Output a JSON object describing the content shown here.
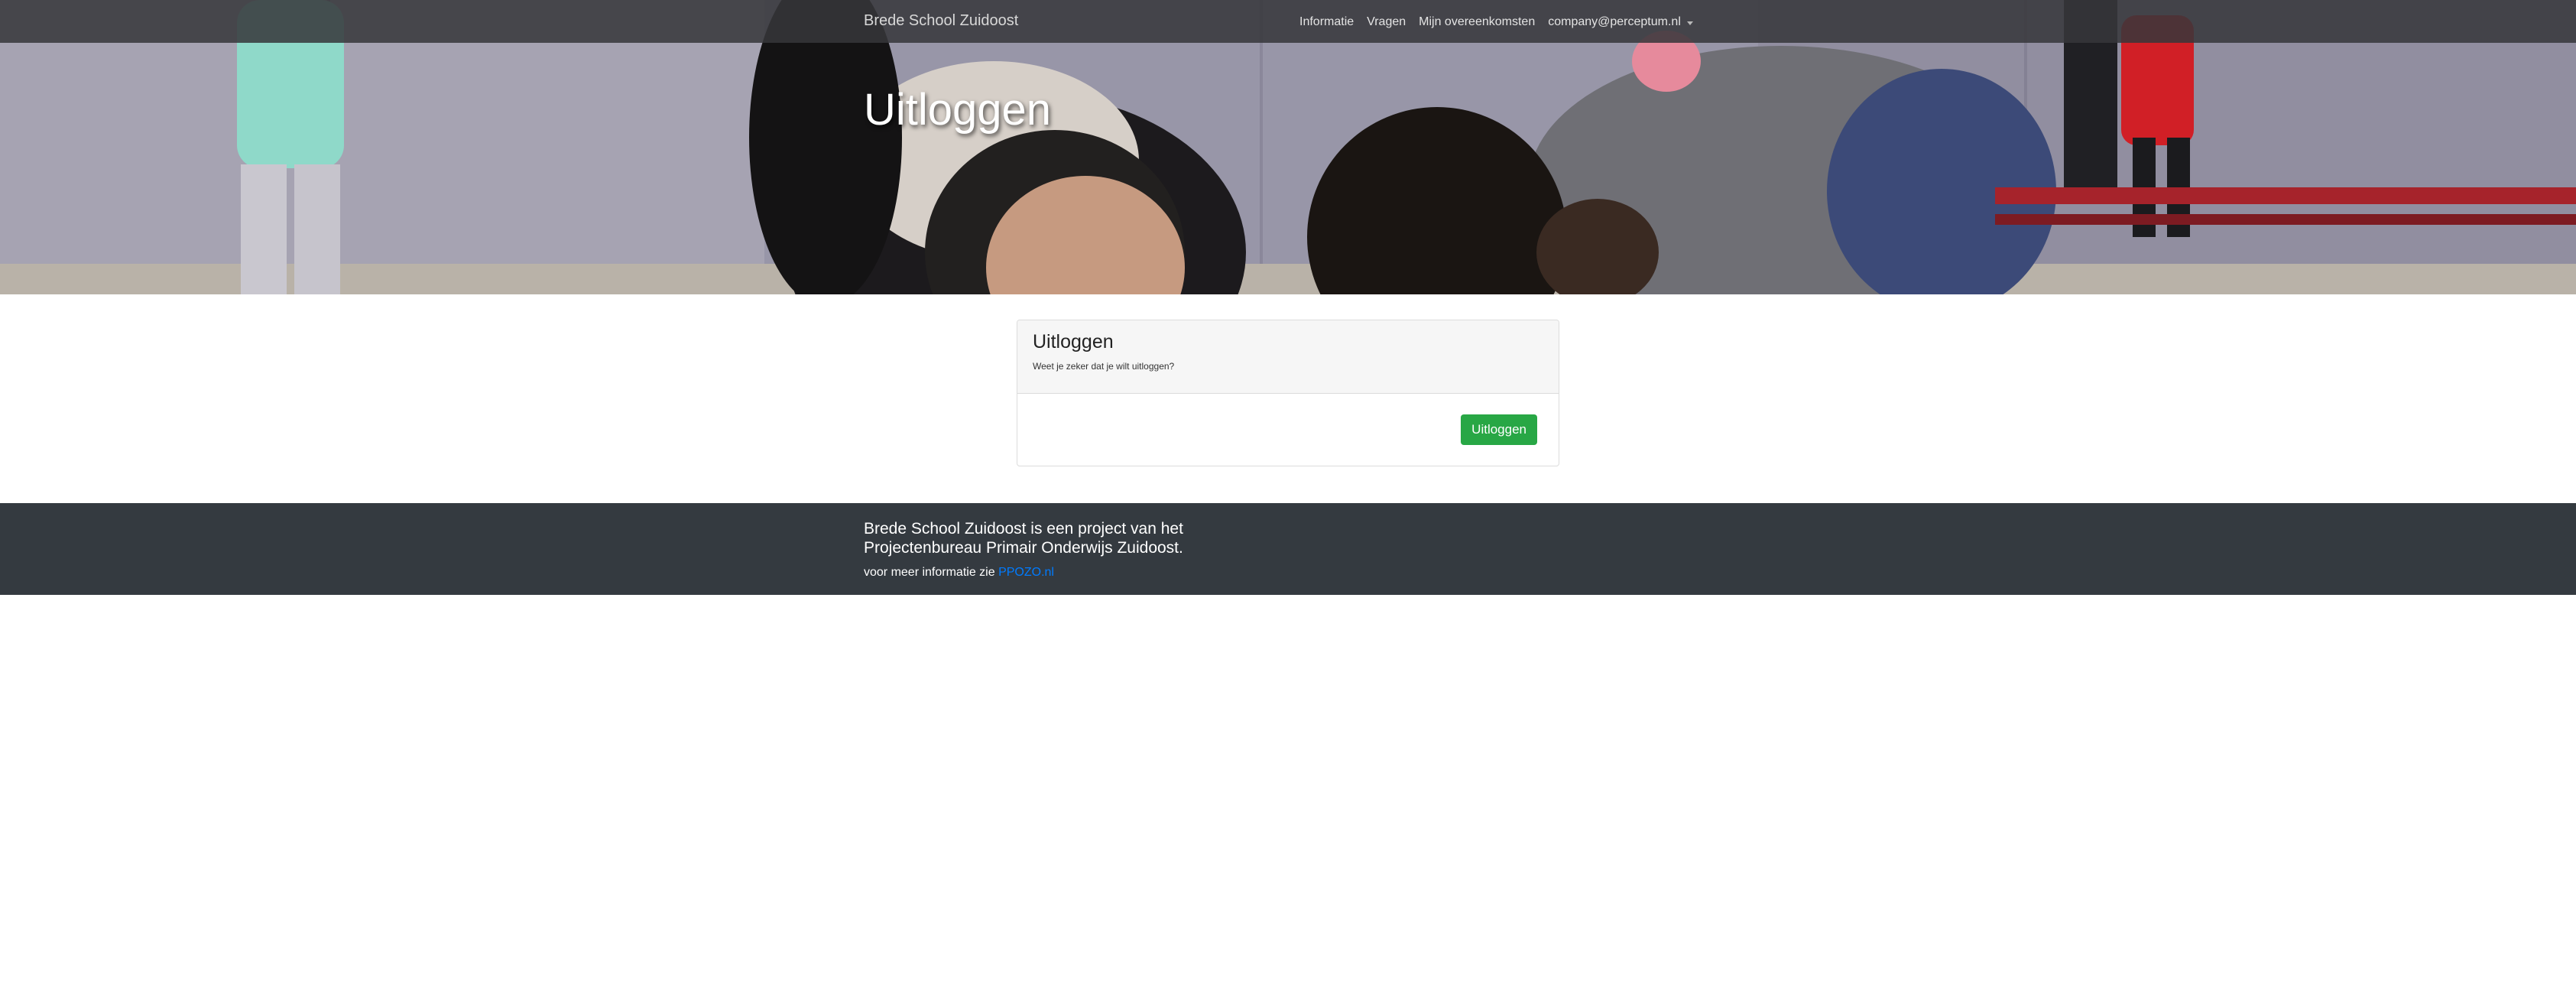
{
  "navbar": {
    "brand": "Brede School Zuidoost",
    "items": [
      {
        "label": "Informatie"
      },
      {
        "label": "Vragen"
      },
      {
        "label": "Mijn overeenkomsten"
      },
      {
        "label": "company@perceptum.nl"
      }
    ]
  },
  "hero": {
    "title": "Uitloggen"
  },
  "card": {
    "title": "Uitloggen",
    "subtitle": "Weet je zeker dat je wilt uitloggen?",
    "button_label": "Uitloggen"
  },
  "footer": {
    "line1": "Brede School Zuidoost is een project van het",
    "line2": "Projectenbureau Primair Onderwijs Zuidoost.",
    "more_prefix": "voor meer informatie zie ",
    "link_text": "PPOZO.nl"
  },
  "colors": {
    "navbar_bg": "#37373a",
    "button_green": "#28a745",
    "footer_bg": "#343a40",
    "link_blue": "#007bff",
    "card_header_bg": "#f6f6f6"
  },
  "icons": {
    "user_menu_caret": "caret-down-icon"
  }
}
